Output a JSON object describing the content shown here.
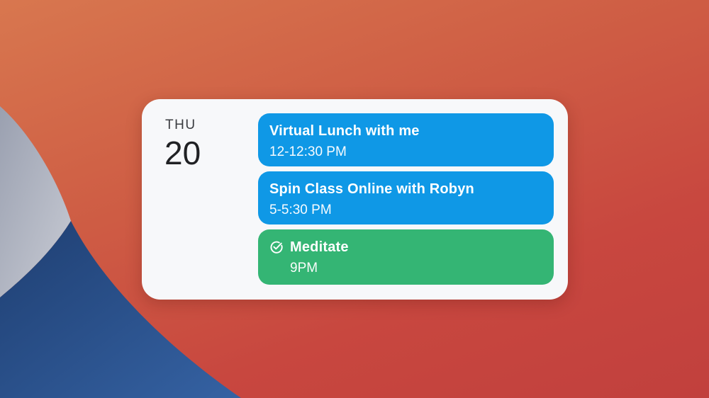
{
  "widget": {
    "day_name": "THU",
    "day_number": "20"
  },
  "events": [
    {
      "title": "Virtual Lunch with me",
      "time": "12-12:30 PM",
      "color": "#0f98e6",
      "completed": false
    },
    {
      "title": "Spin Class Online with Robyn",
      "time": "5-5:30 PM",
      "color": "#0f98e6",
      "completed": false
    },
    {
      "title": "Meditate",
      "time": "9PM",
      "color": "#34b574",
      "completed": true,
      "icon": "check-circle-icon"
    }
  ],
  "colors": {
    "wallpaper_primary": "#cf5f45",
    "wallpaper_blue": "#2a4d82",
    "wallpaper_grey": "#b7bcc8",
    "widget_background": "#f7f8fa"
  }
}
